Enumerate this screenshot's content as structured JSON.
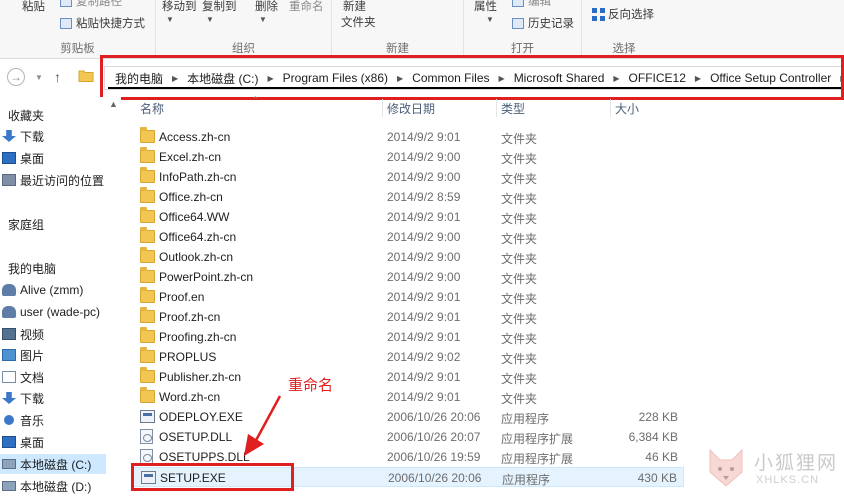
{
  "ribbon": {
    "clipboard": {
      "paste_label": "粘贴",
      "copy_path_label": "复制路径",
      "paste_shortcut_label": "粘贴快捷方式",
      "group_name": "剪贴板"
    },
    "organize": {
      "move_to_label": "移动到",
      "copy_to_label": "复制到",
      "delete_label": "删除",
      "rename_label": "重命名",
      "group_name": "组织"
    },
    "new": {
      "new_folder_line1": "新建",
      "new_folder_line2": "文件夹",
      "group_name": "新建"
    },
    "open": {
      "properties_label": "属性",
      "edit_label": "编辑",
      "history_label": "历史记录",
      "group_name": "打开"
    },
    "select": {
      "invert_label": "反向选择",
      "group_name": "选择"
    }
  },
  "address": {
    "crumbs": [
      "我的电脑",
      "本地磁盘 (C:)",
      "Program Files (x86)",
      "Common Files",
      "Microsoft Shared",
      "OFFICE12",
      "Office Setup Controller"
    ]
  },
  "sidebar": {
    "items": [
      {
        "label": "收藏夹",
        "icon": "star-icon"
      },
      {
        "label": "下载",
        "icon": "download-icon"
      },
      {
        "label": "桌面",
        "icon": "desktop-icon"
      },
      {
        "label": "最近访问的位置",
        "icon": "recent-places-icon"
      },
      {
        "label": "家庭组",
        "icon": "homegroup-icon"
      },
      {
        "label": "我的电脑",
        "icon": "computer-icon"
      },
      {
        "label": "Alive (zmm)",
        "icon": "user-icon"
      },
      {
        "label": "user (wade-pc)",
        "icon": "user-icon"
      },
      {
        "label": "视频",
        "icon": "video-icon"
      },
      {
        "label": "图片",
        "icon": "pictures-icon"
      },
      {
        "label": "文档",
        "icon": "documents-icon"
      },
      {
        "label": "下载",
        "icon": "download-icon"
      },
      {
        "label": "音乐",
        "icon": "music-icon"
      },
      {
        "label": "桌面",
        "icon": "desktop-icon"
      },
      {
        "label": "本地磁盘 (C:)",
        "icon": "drive-icon"
      },
      {
        "label": "本地磁盘 (D:)",
        "icon": "drive-icon"
      }
    ]
  },
  "columns": {
    "name": "名称",
    "date": "修改日期",
    "type": "类型",
    "size": "大小"
  },
  "files": [
    {
      "name": "Access.zh-cn",
      "date": "2014/9/2 9:01",
      "type": "文件夹",
      "size": "",
      "icon": "folder-icon"
    },
    {
      "name": "Excel.zh-cn",
      "date": "2014/9/2 9:00",
      "type": "文件夹",
      "size": "",
      "icon": "folder-icon"
    },
    {
      "name": "InfoPath.zh-cn",
      "date": "2014/9/2 9:00",
      "type": "文件夹",
      "size": "",
      "icon": "folder-icon"
    },
    {
      "name": "Office.zh-cn",
      "date": "2014/9/2 8:59",
      "type": "文件夹",
      "size": "",
      "icon": "folder-icon"
    },
    {
      "name": "Office64.WW",
      "date": "2014/9/2 9:01",
      "type": "文件夹",
      "size": "",
      "icon": "folder-icon"
    },
    {
      "name": "Office64.zh-cn",
      "date": "2014/9/2 9:00",
      "type": "文件夹",
      "size": "",
      "icon": "folder-icon"
    },
    {
      "name": "Outlook.zh-cn",
      "date": "2014/9/2 9:00",
      "type": "文件夹",
      "size": "",
      "icon": "folder-icon"
    },
    {
      "name": "PowerPoint.zh-cn",
      "date": "2014/9/2 9:00",
      "type": "文件夹",
      "size": "",
      "icon": "folder-icon"
    },
    {
      "name": "Proof.en",
      "date": "2014/9/2 9:01",
      "type": "文件夹",
      "size": "",
      "icon": "folder-icon"
    },
    {
      "name": "Proof.zh-cn",
      "date": "2014/9/2 9:01",
      "type": "文件夹",
      "size": "",
      "icon": "folder-icon"
    },
    {
      "name": "Proofing.zh-cn",
      "date": "2014/9/2 9:01",
      "type": "文件夹",
      "size": "",
      "icon": "folder-icon"
    },
    {
      "name": "PROPLUS",
      "date": "2014/9/2 9:02",
      "type": "文件夹",
      "size": "",
      "icon": "folder-icon"
    },
    {
      "name": "Publisher.zh-cn",
      "date": "2014/9/2 9:01",
      "type": "文件夹",
      "size": "",
      "icon": "folder-icon"
    },
    {
      "name": "Word.zh-cn",
      "date": "2014/9/2 9:01",
      "type": "文件夹",
      "size": "",
      "icon": "folder-icon"
    },
    {
      "name": "ODEPLOY.EXE",
      "date": "2006/10/26 20:06",
      "type": "应用程序",
      "size": "228 KB",
      "icon": "exe-icon"
    },
    {
      "name": "OSETUP.DLL",
      "date": "2006/10/26 20:07",
      "type": "应用程序扩展",
      "size": "6,384 KB",
      "icon": "dll-icon"
    },
    {
      "name": "OSETUPPS.DLL",
      "date": "2006/10/26 19:59",
      "type": "应用程序扩展",
      "size": "46 KB",
      "icon": "dll-icon"
    },
    {
      "name": "SETUP.EXE",
      "date": "2006/10/26 20:06",
      "type": "应用程序",
      "size": "430 KB",
      "icon": "exe-icon"
    }
  ],
  "annotation": {
    "text": "重命名"
  },
  "watermark": {
    "cn": "小狐狸网",
    "en": "XHLKS.CN"
  },
  "colors": {
    "highlight_red": "#e02020",
    "selection_blue": "#cde8ff",
    "folder_yellow": "#f2c653"
  }
}
